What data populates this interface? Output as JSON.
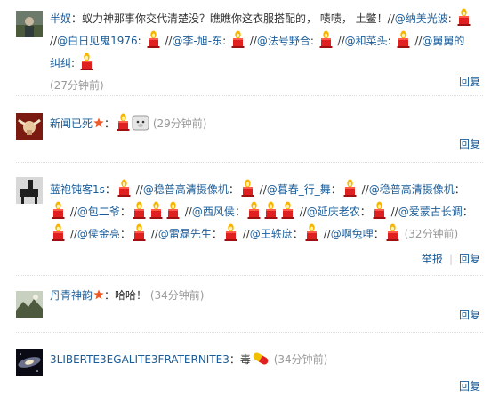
{
  "comments": [
    {
      "user": "半奴",
      "avatar_icon": "outdoor-photo-avatar",
      "text_before": "：蚁力神那事你交代清楚没？瞧瞧你这衣服搭配的， 啧啧， 土鳖！//",
      "mentions": [
        "@纳美光波",
        "@白日见鬼1976",
        "@李-旭-东",
        "@法号野合",
        "@和菜头",
        "@舅舅的纠纠"
      ],
      "time": "(27分钟前)",
      "reply": "回复"
    },
    {
      "user": "新闻已死",
      "avatar_icon": "bull-skull-avatar",
      "time": "(29分钟前)",
      "reply": "回复"
    },
    {
      "user": "蓝袍钝客1s",
      "avatar_icon": "horse-statue-avatar",
      "mentions": [
        "@稳普高清摄像机",
        "@暮春_行_舞",
        "@稳普高清摄像机",
        "@包二爷",
        "@西风侯",
        "@延庆老农",
        "@爱蒙古长调",
        "@侯金亮",
        "@雷磊先生",
        "@王轶庶",
        "@啊兔哩"
      ],
      "time": "(32分钟前)",
      "report": "举报",
      "reply": "回复"
    },
    {
      "user": "丹青神韵",
      "avatar_icon": "landscape-painting-avatar",
      "text": "：哈哈！",
      "time": "(34分钟前)",
      "reply": "回复"
    },
    {
      "user": "3LIBERTE3EGALITE3FRATERNITE3",
      "avatar_icon": "galaxy-avatar",
      "text": "：毒",
      "time": "(34分钟前)",
      "reply": "回复"
    }
  ],
  "colors": {
    "link": "#1a5c99",
    "time": "#999999",
    "candle_body": "#e02020",
    "flame": "#f5a623"
  },
  "icons": {
    "candle": "candle-emoji-icon",
    "pig": "pig-face-emoji-icon",
    "pill": "pill-emoji-icon",
    "vip": "vip-star-badge-icon"
  }
}
